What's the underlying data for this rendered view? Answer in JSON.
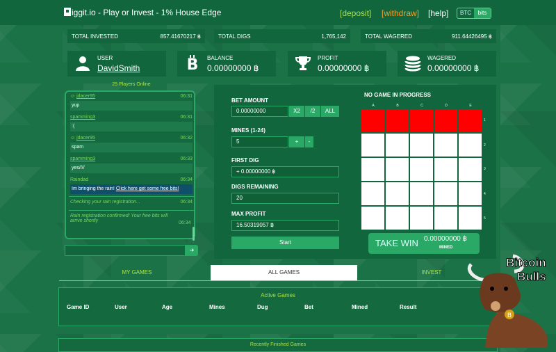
{
  "header": {
    "title": "iggit.io - Play or Invest - 1% House Edge",
    "nav": {
      "deposit": "[deposit]",
      "withdraw": "[withdraw]",
      "help": "[help]"
    },
    "currency": {
      "btc": "BTC",
      "bits": "bits",
      "selected": "bits"
    }
  },
  "stats": {
    "invested": {
      "label": "TOTAL INVESTED",
      "value": "857.41670217 ฿"
    },
    "digs": {
      "label": "TOTAL DIGS",
      "value": "1,765,142"
    },
    "wagered": {
      "label": "TOTAL WAGERED",
      "value": "911.64426495 ฿"
    }
  },
  "cards": {
    "user": {
      "label": "USER",
      "value": "DavidSmith",
      "icon": "user-icon"
    },
    "balance": {
      "label": "BALANCE",
      "value": "0.00000000 ฿",
      "icon": "bitcoin-icon"
    },
    "profit": {
      "label": "PROFIT",
      "value": "0.00000000 ฿",
      "icon": "trophy-icon"
    },
    "wagered": {
      "label": "WAGERED",
      "value": "0.00000000 ฿",
      "icon": "coins-icon"
    }
  },
  "chat": {
    "online": "25 Players Online",
    "messages": [
      {
        "name": "jdacer95",
        "time": "06:31",
        "text": "yup"
      },
      {
        "name": "spamming3",
        "time": "06:31",
        "text": ":("
      },
      {
        "name": "jdacer95",
        "time": "06:32",
        "text": "spam"
      },
      {
        "name": "spamming3",
        "time": "06:33",
        "text": "yes////"
      },
      {
        "name": "Raindad",
        "time": "06:34",
        "text": "Im bringing the rain!",
        "link": "Click here get some free bits!"
      }
    ],
    "system": [
      {
        "text": "Checking your rain registration...",
        "time": "06:34"
      },
      {
        "text": "Rain registration confirmed! Your free bits will arrive shortly",
        "time": "06:34"
      }
    ],
    "send_icon": "arrow-right-icon"
  },
  "form": {
    "bet_label": "BET AMOUNT",
    "bet_value": "0.00000000",
    "x2": "X2",
    "half": "/2",
    "all": "ALL",
    "mines_label": "MINES (1-24)",
    "mines_value": "5",
    "plus": "+",
    "minus": "-",
    "first_label": "FIRST DIG",
    "first_value": "+ 0.00000000 ฿",
    "remaining_label": "DIGS REMAINING",
    "remaining_value": "20",
    "maxprofit_label": "MAX PROFIT",
    "maxprofit_value": "16.50319057 ฿",
    "start": "Start"
  },
  "grid": {
    "title": "NO GAME IN PROGRESS",
    "columns": [
      "A",
      "B",
      "C",
      "D",
      "E"
    ],
    "rows": [
      "1",
      "2",
      "3",
      "4",
      "5"
    ],
    "red_row": 1
  },
  "takewin": {
    "label": "TAKE WIN",
    "amount": "0.00000000 ฿",
    "sub": "MINED"
  },
  "tabs": {
    "my": "MY GAMES",
    "all": "ALL GAMES",
    "invest": "INVEST",
    "active": "all"
  },
  "active_games": {
    "title": "Active Games",
    "headers": [
      "Game ID",
      "User",
      "Age",
      "Mines",
      "Dug",
      "Bet",
      "Mined",
      "Result"
    ]
  },
  "recent_games": {
    "title": "Recently Finished Games"
  },
  "watermark": {
    "line1": "Bitcoin",
    "line2": "Bulls"
  }
}
